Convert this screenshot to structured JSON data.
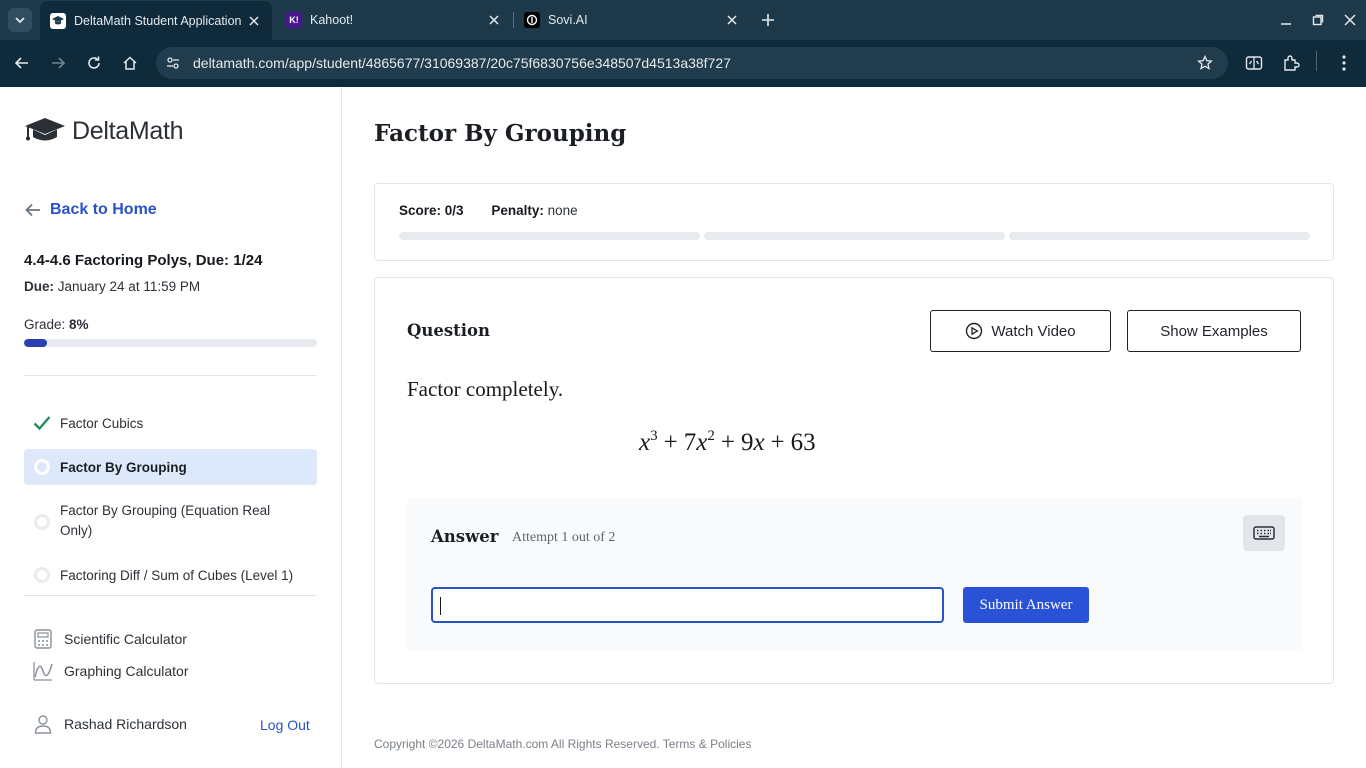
{
  "browser": {
    "tabs": [
      {
        "title": "DeltaMath Student Application",
        "active": true
      },
      {
        "title": "Kahoot!",
        "active": false,
        "badge": "K!"
      },
      {
        "title": "Sovi.AI",
        "active": false
      }
    ],
    "url": "deltamath.com/app/student/4865677/31069387/20c75f6830756e348507d4513a38f727"
  },
  "sidebar": {
    "logo_text": "DeltaMath",
    "back_label": "Back to Home",
    "assignment_title": "4.4-4.6 Factoring Polys, Due: 1/24",
    "due_label": "Due:",
    "due_value": "January 24 at 11:59 PM",
    "grade_label": "Grade:",
    "grade_value": "8%",
    "grade_fraction": 0.08,
    "skills": [
      {
        "label": "Factor Cubics",
        "status": "complete"
      },
      {
        "label": "Factor By Grouping",
        "status": "active"
      },
      {
        "label": "Factor By Grouping (Equation Real Only)",
        "status": "todo"
      },
      {
        "label": "Factoring Diff / Sum of Cubes (Level 1)",
        "status": "todo"
      }
    ],
    "tools": [
      {
        "label": "Scientific Calculator",
        "icon": "calculator-icon"
      },
      {
        "label": "Graphing Calculator",
        "icon": "graph-icon"
      }
    ],
    "user_name": "Rashad Richardson",
    "logout_label": "Log Out"
  },
  "main": {
    "title": "Factor By Grouping",
    "score_label": "Score:",
    "score_value": "0/3",
    "penalty_label": "Penalty:",
    "penalty_value": "none",
    "question_label": "Question",
    "watch_video_label": "Watch Video",
    "show_examples_label": "Show Examples",
    "prompt": "Factor completely.",
    "expression": {
      "t1_var": "x",
      "t1_exp": "3",
      "op1": "+",
      "t2_coef": "7",
      "t2_var": "x",
      "t2_exp": "2",
      "op2": "+",
      "t3_coef": "9",
      "t3_var": "x",
      "op3": "+",
      "t4": "63"
    },
    "answer_label": "Answer",
    "attempt_text": "Attempt 1 out of 2",
    "answer_value": "",
    "submit_label": "Submit Answer"
  },
  "footer": {
    "copyright": "Copyright ©2026 DeltaMath.com All Rights Reserved.",
    "terms": "Terms & Policies"
  },
  "colors": {
    "accent": "#2a52d6",
    "link": "#2a52c7",
    "active_skill_bg": "#dde9fb",
    "check": "#1e8e5a",
    "chrome_bg": "#1e3a4a"
  }
}
